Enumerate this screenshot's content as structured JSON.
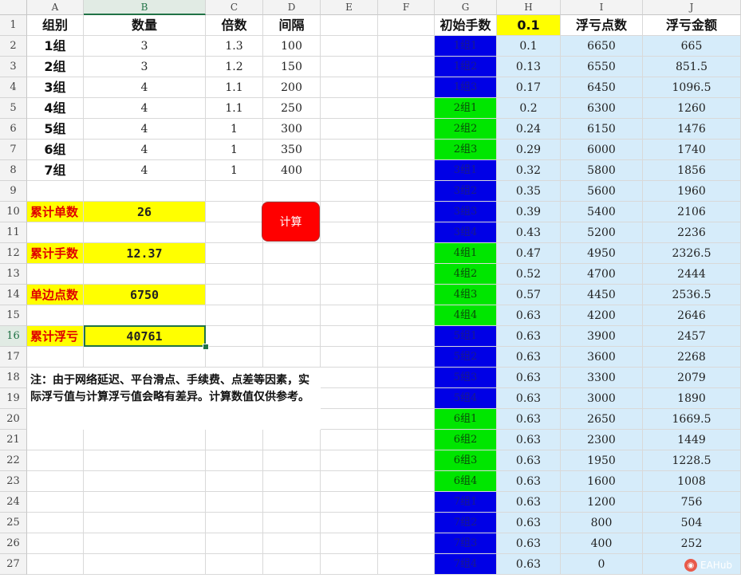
{
  "columns": [
    "A",
    "B",
    "C",
    "D",
    "E",
    "F",
    "G",
    "H",
    "I",
    "J"
  ],
  "selected_column": "B",
  "selected_row": "16",
  "rows": [
    "1",
    "2",
    "3",
    "4",
    "5",
    "6",
    "7",
    "8",
    "9",
    "10",
    "11",
    "12",
    "13",
    "14",
    "15",
    "16",
    "17",
    "18",
    "19",
    "20",
    "21",
    "22",
    "23",
    "24",
    "25",
    "26",
    "27"
  ],
  "left_table": {
    "headers": [
      "组别",
      "数量",
      "倍数",
      "间隔"
    ],
    "rows": [
      [
        "1组",
        "3",
        "1.3",
        "100"
      ],
      [
        "2组",
        "3",
        "1.2",
        "150"
      ],
      [
        "3组",
        "4",
        "1.1",
        "200"
      ],
      [
        "4组",
        "4",
        "1.1",
        "250"
      ],
      [
        "5组",
        "4",
        "1",
        "300"
      ],
      [
        "6组",
        "4",
        "1",
        "350"
      ],
      [
        "7组",
        "4",
        "1",
        "400"
      ]
    ]
  },
  "summary": [
    {
      "label": "累计单数",
      "value": "26"
    },
    {
      "label": "累计手数",
      "value": "12.37"
    },
    {
      "label": "单边点数",
      "value": "6750"
    },
    {
      "label": "累计浮亏",
      "value": "40761"
    }
  ],
  "calc_button": "计算",
  "note": "注：由于网络延迟、平台滑点、手续费、点差等因素，实际浮亏值与计算浮亏值会略有差异。计算数值仅供参考。",
  "right_table": {
    "headers": [
      "初始手数",
      "0.1",
      "浮亏点数",
      "浮亏金额"
    ],
    "rows": [
      {
        "g": "1组1",
        "h": "0.1",
        "i": "6650",
        "j": "665",
        "c": "blue"
      },
      {
        "g": "1组2",
        "h": "0.13",
        "i": "6550",
        "j": "851.5",
        "c": "blue"
      },
      {
        "g": "1组3",
        "h": "0.17",
        "i": "6450",
        "j": "1096.5",
        "c": "blue"
      },
      {
        "g": "2组1",
        "h": "0.2",
        "i": "6300",
        "j": "1260",
        "c": "green"
      },
      {
        "g": "2组2",
        "h": "0.24",
        "i": "6150",
        "j": "1476",
        "c": "green"
      },
      {
        "g": "2组3",
        "h": "0.29",
        "i": "6000",
        "j": "1740",
        "c": "green"
      },
      {
        "g": "3组1",
        "h": "0.32",
        "i": "5800",
        "j": "1856",
        "c": "blue"
      },
      {
        "g": "3组2",
        "h": "0.35",
        "i": "5600",
        "j": "1960",
        "c": "blue"
      },
      {
        "g": "3组3",
        "h": "0.39",
        "i": "5400",
        "j": "2106",
        "c": "blue"
      },
      {
        "g": "3组4",
        "h": "0.43",
        "i": "5200",
        "j": "2236",
        "c": "blue"
      },
      {
        "g": "4组1",
        "h": "0.47",
        "i": "4950",
        "j": "2326.5",
        "c": "green"
      },
      {
        "g": "4组2",
        "h": "0.52",
        "i": "4700",
        "j": "2444",
        "c": "green"
      },
      {
        "g": "4组3",
        "h": "0.57",
        "i": "4450",
        "j": "2536.5",
        "c": "green"
      },
      {
        "g": "4组4",
        "h": "0.63",
        "i": "4200",
        "j": "2646",
        "c": "green"
      },
      {
        "g": "5组1",
        "h": "0.63",
        "i": "3900",
        "j": "2457",
        "c": "blue"
      },
      {
        "g": "5组2",
        "h": "0.63",
        "i": "3600",
        "j": "2268",
        "c": "blue"
      },
      {
        "g": "5组3",
        "h": "0.63",
        "i": "3300",
        "j": "2079",
        "c": "blue"
      },
      {
        "g": "5组4",
        "h": "0.63",
        "i": "3000",
        "j": "1890",
        "c": "blue"
      },
      {
        "g": "6组1",
        "h": "0.63",
        "i": "2650",
        "j": "1669.5",
        "c": "green"
      },
      {
        "g": "6组2",
        "h": "0.63",
        "i": "2300",
        "j": "1449",
        "c": "green"
      },
      {
        "g": "6组3",
        "h": "0.63",
        "i": "1950",
        "j": "1228.5",
        "c": "green"
      },
      {
        "g": "6组4",
        "h": "0.63",
        "i": "1600",
        "j": "1008",
        "c": "green"
      },
      {
        "g": "7组1",
        "h": "0.63",
        "i": "1200",
        "j": "756",
        "c": "blue"
      },
      {
        "g": "7组2",
        "h": "0.63",
        "i": "800",
        "j": "504",
        "c": "blue"
      },
      {
        "g": "7组3",
        "h": "0.63",
        "i": "400",
        "j": "252",
        "c": "blue"
      },
      {
        "g": "7组4",
        "h": "0.63",
        "i": "0",
        "j": "",
        "c": "blue"
      }
    ]
  },
  "watermark": "EAHub",
  "colors": {
    "yellow": "#ffff00",
    "light_blue": "#d6ecfa",
    "blue": "#0000e6",
    "green": "#00e600",
    "red": "#ff0000",
    "selection": "#217346"
  }
}
